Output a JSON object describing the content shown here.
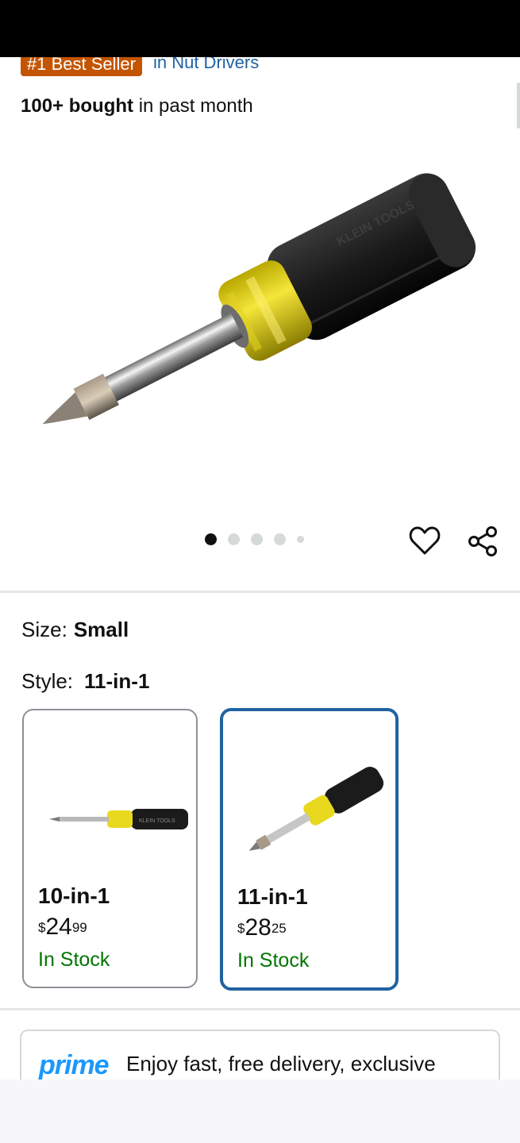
{
  "header": {
    "badge_label": "#1 Best Seller",
    "badge_category": "in Nut Drivers",
    "bought_count": "100+ bought",
    "bought_suffix": " in past month"
  },
  "gallery": {
    "image_count": 5,
    "active_index": 0,
    "wishlist_icon": "heart-icon",
    "share_icon": "share-icon",
    "brand_marking": "KLEIN TOOLS"
  },
  "size": {
    "label": "Size:",
    "value": "Small"
  },
  "style": {
    "label": "Style:",
    "value": "11-in-1",
    "options": [
      {
        "title": "10-in-1",
        "price_symbol": "$",
        "price_whole": "24",
        "price_fraction": "99",
        "stock": "In Stock",
        "selected": false
      },
      {
        "title": "11-in-1",
        "price_symbol": "$",
        "price_whole": "28",
        "price_fraction": "25",
        "stock": "In Stock",
        "selected": true
      }
    ]
  },
  "prime": {
    "logo": "prime",
    "text": "Enjoy fast, free delivery, exclusive"
  },
  "colors": {
    "badge": "#c45500",
    "link": "#2162a1",
    "stock": "#007600",
    "selected_border": "#2162a1",
    "prime": "#1a98ff"
  }
}
